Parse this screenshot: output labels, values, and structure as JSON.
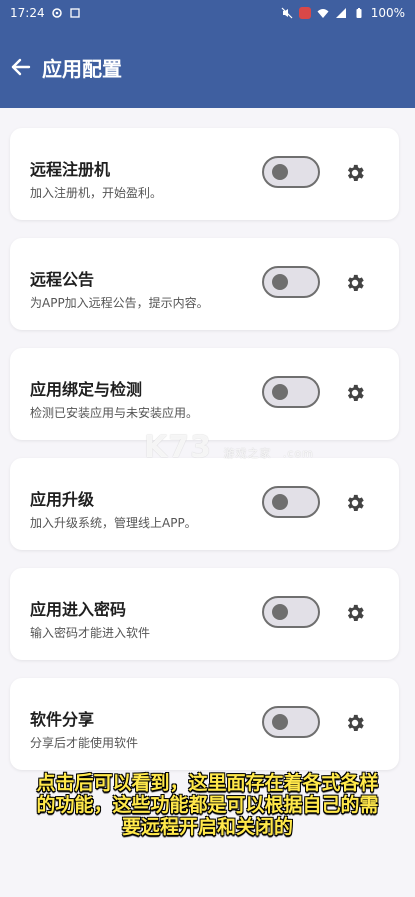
{
  "status_bar": {
    "time": "17:24",
    "battery": "100%"
  },
  "app_bar": {
    "title": "应用配置"
  },
  "items": [
    {
      "title": "远程注册机",
      "desc": "加入注册机，开始盈利。",
      "enabled": false
    },
    {
      "title": "远程公告",
      "desc": "为APP加入远程公告，提示内容。",
      "enabled": false
    },
    {
      "title": "应用绑定与检测",
      "desc": "检测已安装应用与未安装应用。",
      "enabled": false
    },
    {
      "title": "应用升级",
      "desc": "加入升级系统，管理线上APP。",
      "enabled": false
    },
    {
      "title": "应用进入密码",
      "desc": "输入密码才能进入软件",
      "enabled": false
    },
    {
      "title": "软件分享",
      "desc": "分享后才能使用软件",
      "enabled": false
    }
  ],
  "watermark": {
    "brand": "K73",
    "cn": "游戏之家",
    "domain": ".com"
  },
  "caption": {
    "line1": "点击后可以看到，这里面存在着各式各样",
    "line2": "的功能，这些功能都是可以根据自己的需",
    "line3": "要远程开启和关闭的"
  },
  "colors": {
    "appbar": "#3f5fa0",
    "background": "#f6f5f9",
    "caption": "#ffe84a"
  }
}
